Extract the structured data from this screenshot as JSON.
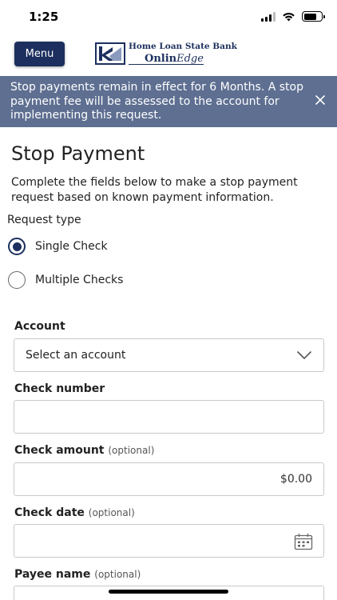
{
  "status_bar": {
    "time": "1:25",
    "signal_icon": "cellular-signal-icon",
    "wifi_icon": "wifi-icon",
    "battery_icon": "battery-icon"
  },
  "header": {
    "menu_label": "Menu",
    "logo": {
      "line1": "Home Loan State Bank",
      "line2_a": "Onlin",
      "line2_b": "Edge",
      "icon": "bank-logo-icon"
    }
  },
  "banner": {
    "text": "Stop payments remain in effect for 6 Months. A stop payment fee will be assessed to the account for implementing this request.",
    "close_icon": "close-icon",
    "background": "#5e6f91"
  },
  "page": {
    "title": "Stop Payment",
    "intro": "Complete the fields below to make a stop payment request based on known payment information."
  },
  "request_type": {
    "label": "Request type",
    "options": [
      {
        "label": "Single Check",
        "selected": true
      },
      {
        "label": "Multiple Checks",
        "selected": false
      }
    ]
  },
  "form": {
    "account": {
      "label": "Account",
      "value": "Select an account",
      "icon": "chevron-down-icon"
    },
    "check_number": {
      "label": "Check number",
      "value": ""
    },
    "check_amount": {
      "label": "Check amount",
      "optional": "(optional)",
      "value": "$0.00"
    },
    "check_date": {
      "label": "Check date",
      "optional": "(optional)",
      "value": "",
      "icon": "calendar-icon"
    },
    "payee_name": {
      "label": "Payee name",
      "optional": "(optional)",
      "value": ""
    }
  },
  "colors": {
    "brand": "#1c2f5e",
    "accent_banner": "#5e6f91",
    "border": "#c9c9c9"
  }
}
